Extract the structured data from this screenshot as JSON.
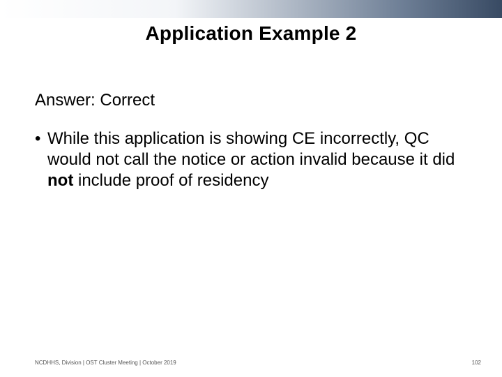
{
  "title": "Application Example 2",
  "answer_line": "Answer: Correct",
  "bullet": {
    "dot": "•",
    "pre": "While this application is showing CE incorrectly, QC would not call the notice or action invalid because it did ",
    "bold": "not",
    "post": " include proof of residency"
  },
  "footer": {
    "left": "NCDHHS, Division | OST Cluster Meeting | October 2019",
    "right": "102"
  }
}
